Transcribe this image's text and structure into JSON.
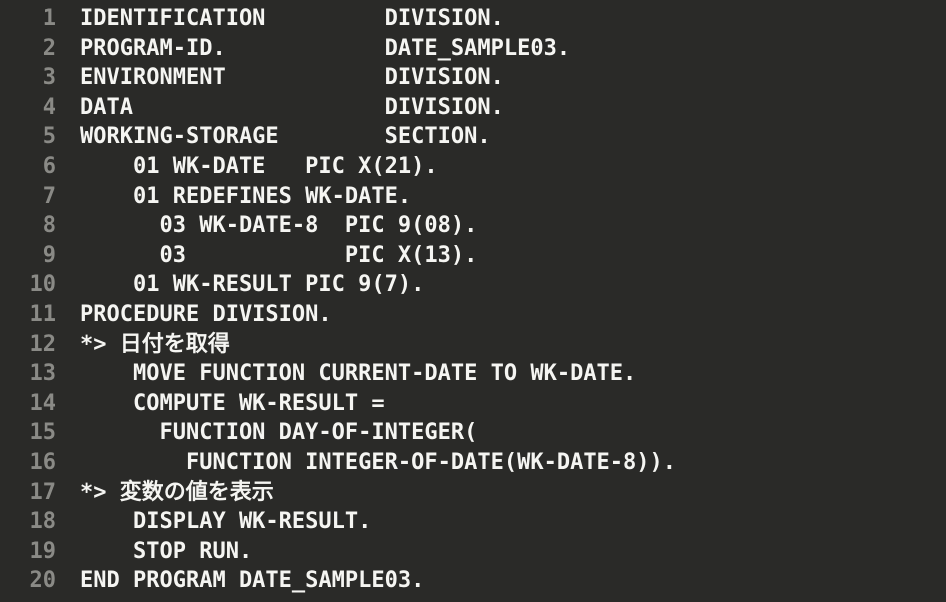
{
  "code": {
    "lines": [
      {
        "num": "1",
        "text": "IDENTIFICATION         DIVISION."
      },
      {
        "num": "2",
        "text": "PROGRAM-ID.            DATE_SAMPLE03."
      },
      {
        "num": "3",
        "text": "ENVIRONMENT            DIVISION."
      },
      {
        "num": "4",
        "text": "DATA                   DIVISION."
      },
      {
        "num": "5",
        "text": "WORKING-STORAGE        SECTION."
      },
      {
        "num": "6",
        "text": "    01 WK-DATE   PIC X(21)."
      },
      {
        "num": "7",
        "text": "    01 REDEFINES WK-DATE."
      },
      {
        "num": "8",
        "text": "      03 WK-DATE-8  PIC 9(08)."
      },
      {
        "num": "9",
        "text": "      03            PIC X(13)."
      },
      {
        "num": "10",
        "text": "    01 WK-RESULT PIC 9(7)."
      },
      {
        "num": "11",
        "text": "PROCEDURE DIVISION."
      },
      {
        "num": "12",
        "text": "*> 日付を取得"
      },
      {
        "num": "13",
        "text": "    MOVE FUNCTION CURRENT-DATE TO WK-DATE."
      },
      {
        "num": "14",
        "text": "    COMPUTE WK-RESULT ="
      },
      {
        "num": "15",
        "text": "      FUNCTION DAY-OF-INTEGER("
      },
      {
        "num": "16",
        "text": "        FUNCTION INTEGER-OF-DATE(WK-DATE-8))."
      },
      {
        "num": "17",
        "text": "*> 変数の値を表示"
      },
      {
        "num": "18",
        "text": "    DISPLAY WK-RESULT."
      },
      {
        "num": "19",
        "text": "    STOP RUN."
      },
      {
        "num": "20",
        "text": "END PROGRAM DATE_SAMPLE03."
      }
    ]
  }
}
